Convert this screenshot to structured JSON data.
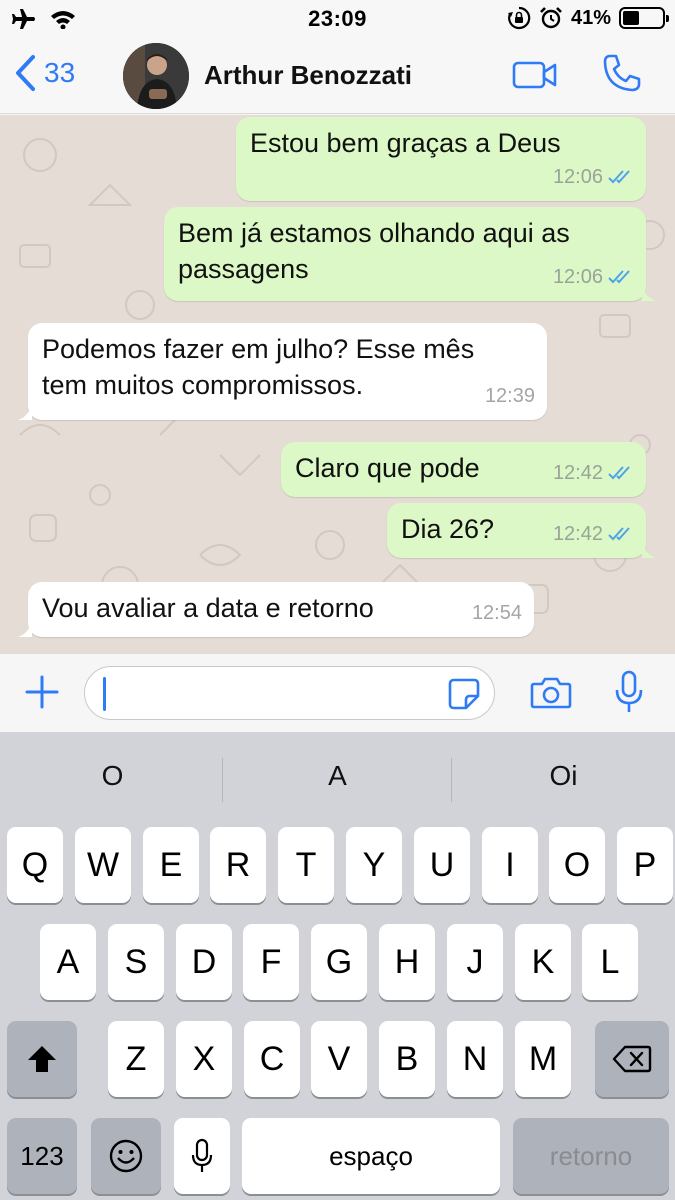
{
  "status_bar": {
    "time": "23:09",
    "battery_percent": "41%",
    "battery_level": 0.41,
    "icons": [
      "airplane-icon",
      "wifi-icon",
      "orientation-lock-icon",
      "alarm-icon",
      "battery-icon"
    ]
  },
  "header": {
    "back_count": "33",
    "contact_name": "Arthur Benozzati",
    "icons": [
      "chevron-left-icon",
      "video-call-icon",
      "phone-icon"
    ]
  },
  "messages": [
    {
      "direction": "out",
      "text": "Estou bem graças a Deus",
      "time": "12:06",
      "read": true
    },
    {
      "direction": "out",
      "text": "Bem já estamos olhando aqui as\npassagens",
      "time": "12:06",
      "read": true
    },
    {
      "direction": "in",
      "text": "Podemos fazer em julho? Esse mês\ntem muitos compromissos.",
      "time": "12:39"
    },
    {
      "direction": "out",
      "text": "Claro que pode",
      "time": "12:42",
      "read": true
    },
    {
      "direction": "out",
      "text": "Dia 26?",
      "time": "12:42",
      "read": true
    },
    {
      "direction": "in",
      "text": "Vou avaliar a data e retorno",
      "time": "12:54"
    }
  ],
  "composer": {
    "input_value": "",
    "icons": [
      "plus-icon",
      "sticker-icon",
      "camera-icon",
      "microphone-icon"
    ]
  },
  "keyboard": {
    "suggestions": [
      "O",
      "A",
      "Oi"
    ],
    "row1": [
      "Q",
      "W",
      "E",
      "R",
      "T",
      "Y",
      "U",
      "I",
      "O",
      "P"
    ],
    "row2": [
      "A",
      "S",
      "D",
      "F",
      "G",
      "H",
      "J",
      "K",
      "L"
    ],
    "row3": [
      "Z",
      "X",
      "C",
      "V",
      "B",
      "N",
      "M"
    ],
    "numbers_key": "123",
    "space_key": "espaço",
    "return_key": "retorno"
  }
}
